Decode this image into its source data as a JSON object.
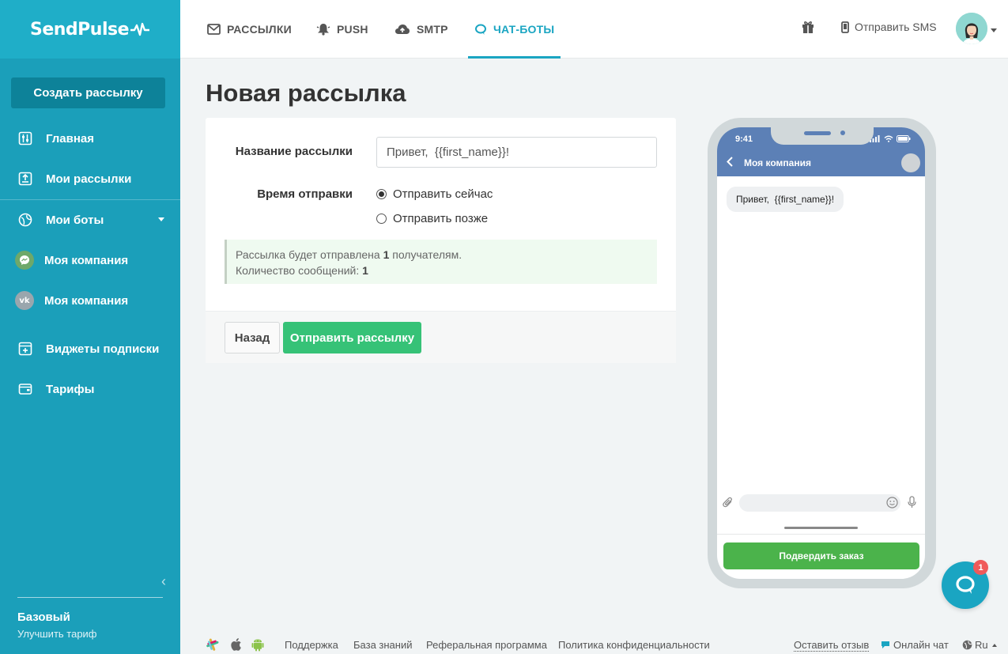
{
  "brand": {
    "logo_text": "SendPulse"
  },
  "sidebar": {
    "create_button": "Создать рассылку",
    "items": [
      {
        "label": "Главная",
        "icon": "sliders-icon"
      },
      {
        "label": "Мои рассылки",
        "icon": "upload-icon"
      },
      {
        "label": "Мои боты",
        "icon": "globe-icon"
      },
      {
        "label": "Моя компания",
        "icon": "messenger-icon"
      },
      {
        "label": "Моя компания",
        "icon": "vk-icon"
      },
      {
        "label": "Виджеты подписки",
        "icon": "widget-icon"
      },
      {
        "label": "Тарифы",
        "icon": "wallet-icon"
      }
    ],
    "plan_name": "Базовый",
    "plan_upgrade": "Улучшить тариф"
  },
  "topbar": {
    "tabs": [
      {
        "label": "РАССЫЛКИ",
        "icon": "mail-icon"
      },
      {
        "label": "PUSH",
        "icon": "bell-icon"
      },
      {
        "label": "SMTP",
        "icon": "cloud-icon"
      },
      {
        "label": "ЧАТ-БОТЫ",
        "icon": "chat-icon",
        "active": true
      }
    ],
    "sms_label": "Отправить SMS"
  },
  "page": {
    "title": "Новая рассылка",
    "form": {
      "name_label": "Название рассылки",
      "name_value": "Привет,  {{first_name}}!",
      "time_label": "Время отправки",
      "options": [
        "Отправить сейчас",
        "Отправить позже"
      ],
      "selected_option": "Отправить сейчас"
    },
    "info": {
      "line1_prefix": "Рассылка будет отправлена ",
      "recipients": "1",
      "line1_suffix": " получателям.",
      "line2_prefix": "Количество сообщений: ",
      "messages": "1"
    },
    "buttons": {
      "back": "Назад",
      "send": "Отправить рассылку"
    }
  },
  "phone": {
    "time": "9:41",
    "chat_title": "Моя компания",
    "message": "Привет,  {{first_name}}!",
    "confirm_button": "Подвердить заказ"
  },
  "chat_widget": {
    "badge": "1"
  },
  "footer": {
    "links": [
      "Поддержка",
      "База знаний",
      "Реферальная программа",
      "Политика конфиденциальности"
    ],
    "feedback": "Оставить отзыв",
    "online_chat": "Онлайн чат",
    "language": "Ru"
  },
  "colors": {
    "sidebar": "#1b9fba",
    "accent": "#1aa5c2",
    "send_button": "#36c277",
    "phone_header": "#5c80b6",
    "confirm_button": "#4bb34b"
  }
}
